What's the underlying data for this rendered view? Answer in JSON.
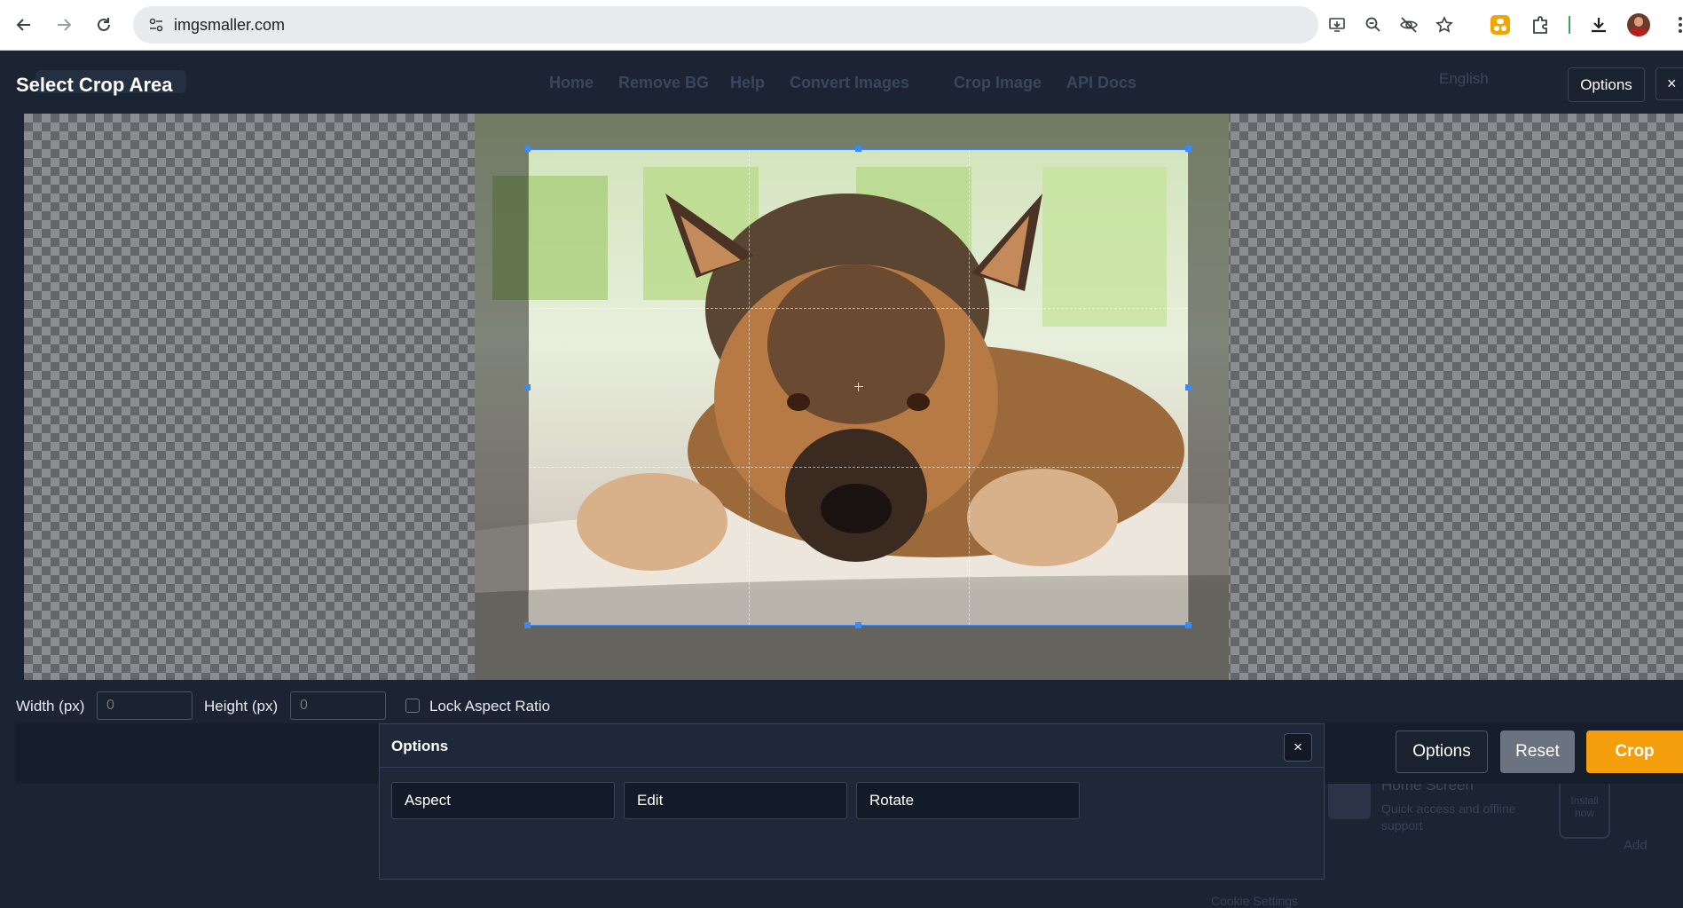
{
  "browser": {
    "url": "imgsmaller.com",
    "icons": {
      "back": "back-arrow-icon",
      "forward": "forward-arrow-icon",
      "reload": "reload-icon",
      "site_info": "tune-icon",
      "install": "install-app-icon",
      "zoom": "zoom-icon",
      "tracking": "eye-off-icon",
      "bookmark": "star-icon",
      "extension_color": "#f0a500",
      "extensions": "puzzle-icon",
      "downloads": "download-icon",
      "profile": "avatar"
    }
  },
  "background_page": {
    "nav": [
      "Home",
      "Remove BG",
      "Help",
      "Convert Images",
      "Crop Image",
      "API Docs"
    ],
    "language": "English",
    "promo_title": "Home Screen",
    "promo_subtitle": "Quick access and offline support",
    "install_label": "Install now",
    "add_label": "Add",
    "cookie_text": "Cookie Settings"
  },
  "crop_modal": {
    "title": "Select Crop Area",
    "options_label": "Options",
    "close_label": "×",
    "width_label": "Width (px)",
    "width_value": "0",
    "height_label": "Height (px)",
    "height_value": "0",
    "lock_label": "Lock Aspect Ratio",
    "lock_checked": false,
    "footer": {
      "options_label": "Options",
      "reset_label": "Reset",
      "crop_label": "Crop"
    },
    "colors": {
      "accent": "#f59e0b",
      "reset": "#6b7280",
      "crop_border": "#3b8bf5"
    }
  },
  "options_popup": {
    "title": "Options",
    "close_label": "×",
    "buttons": [
      "Aspect",
      "Edit",
      "Rotate"
    ]
  }
}
